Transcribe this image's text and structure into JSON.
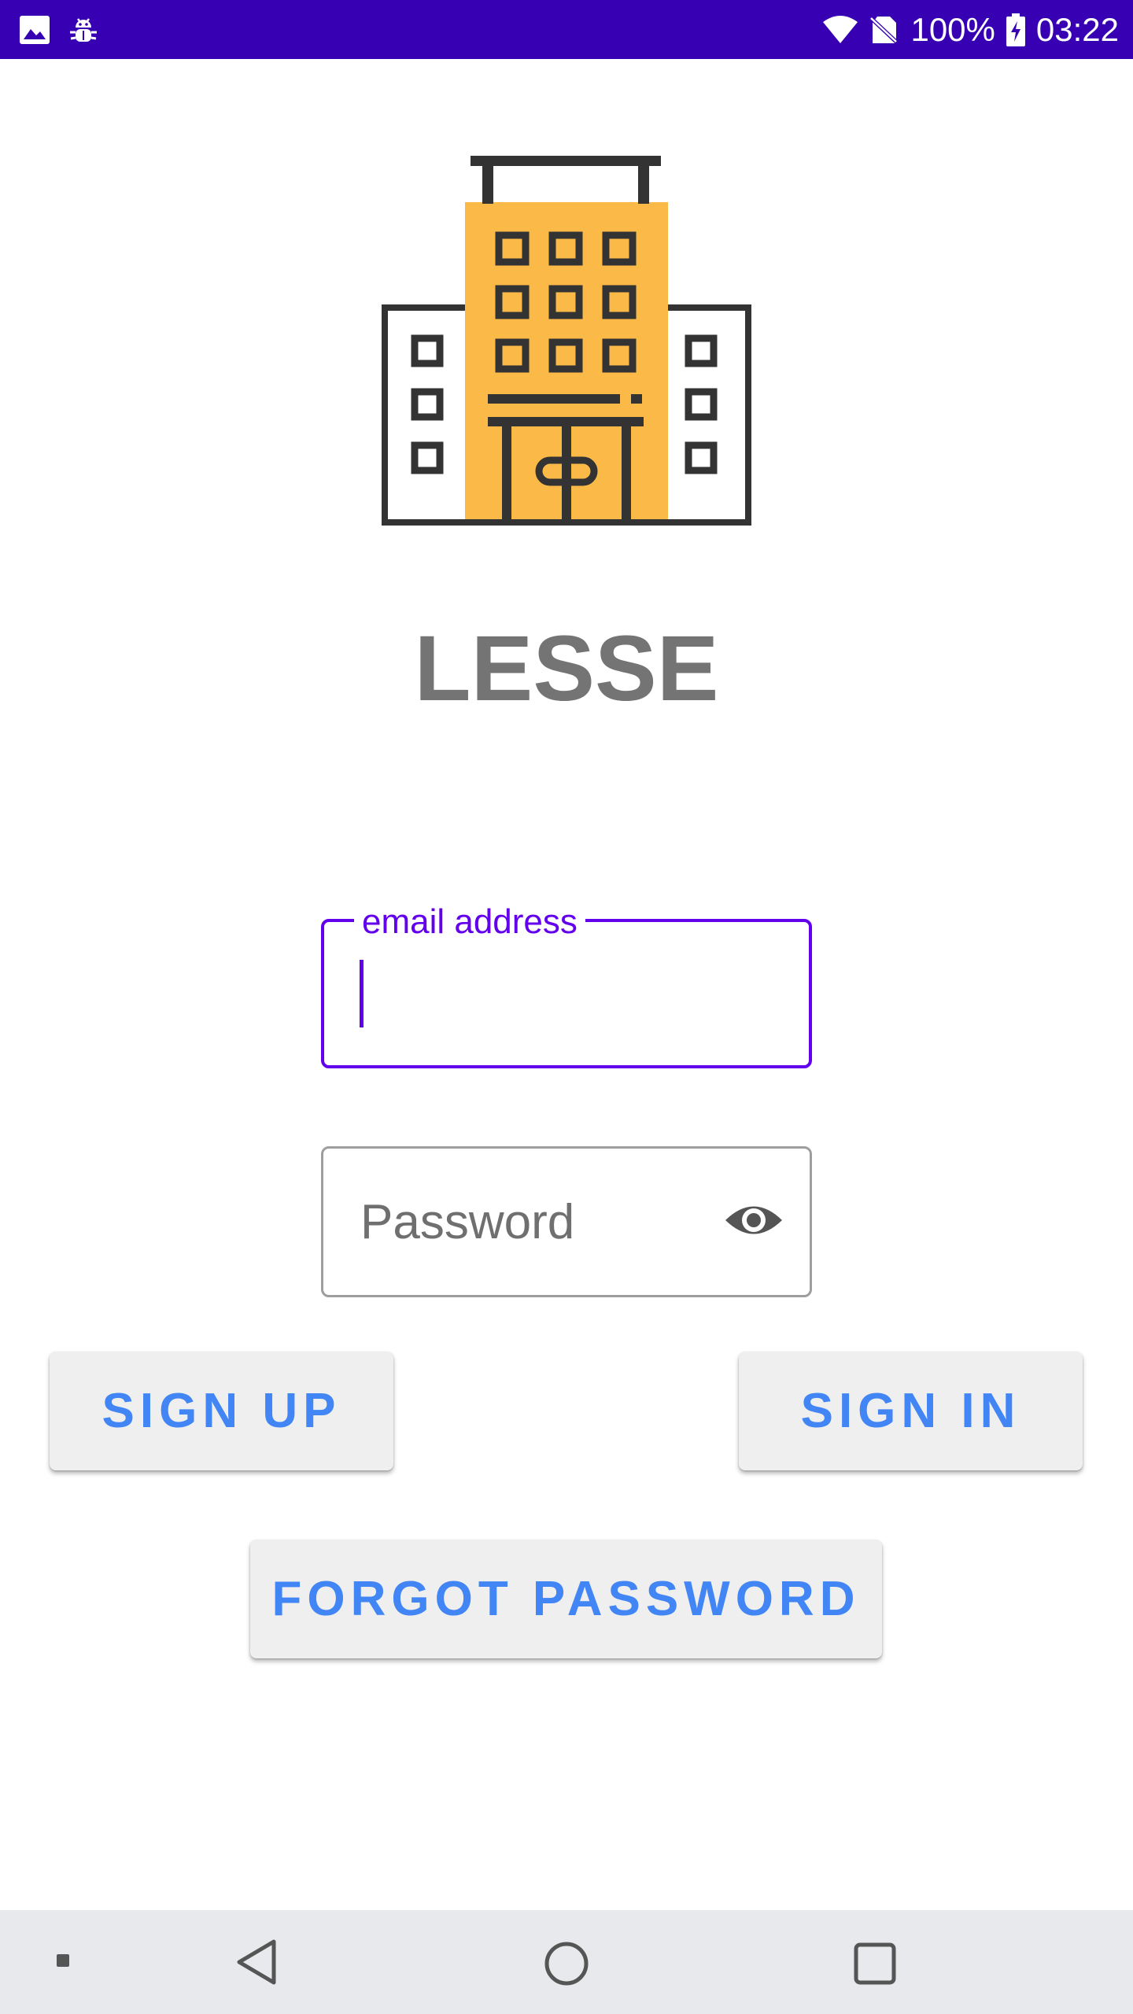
{
  "status_bar": {
    "battery_percent": "100%",
    "time": "03:22",
    "left_icons": [
      "image-icon",
      "android-debug-icon"
    ],
    "right_icons": [
      "wifi-icon",
      "no-sim-icon",
      "battery-charging-icon"
    ]
  },
  "app": {
    "title": "LESSE",
    "logo": "hotel-building-icon"
  },
  "form": {
    "email_label": "email address",
    "email_value": "",
    "password_placeholder": "Password"
  },
  "buttons": {
    "sign_up": "SIGN UP",
    "sign_in": "SIGN IN",
    "forgot_password": "FORGOT PASSWORD"
  },
  "nav_bar": {
    "items": [
      "back-icon",
      "home-icon",
      "recents-icon"
    ]
  },
  "colors": {
    "status_bar": "#3700B3",
    "accent": "#6200EE",
    "button_text": "#4285F4",
    "button_bg": "#EFEFEF",
    "building_yellow": "#FBBA48",
    "title_gray": "#747474"
  }
}
